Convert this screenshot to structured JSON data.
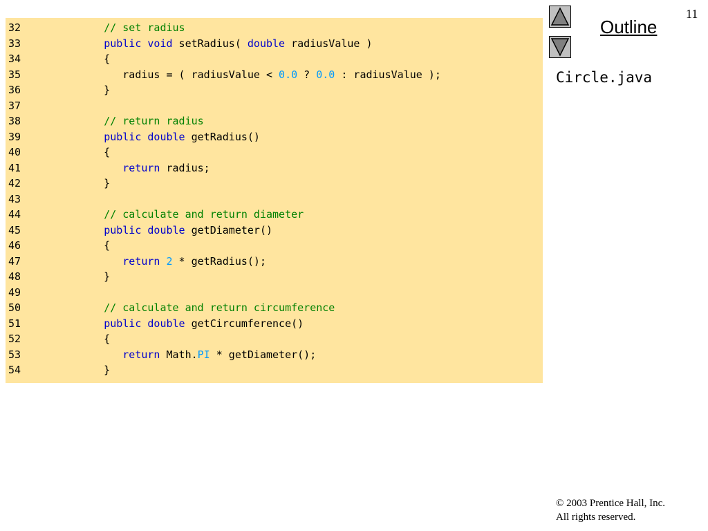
{
  "slide": {
    "page_number": "11",
    "outline_label": "Outline",
    "filename": "Circle.java",
    "copyright_line1": "© 2003 Prentice Hall, Inc.",
    "copyright_line2": "All rights reserved."
  },
  "nav": {
    "up_icon": "triangle-up-icon",
    "down_icon": "triangle-down-icon"
  },
  "colors": {
    "code_background": "#ffe59f",
    "keyword": "#0000cc",
    "comment": "#008000",
    "literal": "#0099ff"
  },
  "code": [
    {
      "ln": "32",
      "tokens": [
        {
          "t": "      "
        },
        {
          "t": "// set radius",
          "c": "cm"
        }
      ]
    },
    {
      "ln": "33",
      "tokens": [
        {
          "t": "      "
        },
        {
          "t": "public",
          "c": "kw"
        },
        {
          "t": " "
        },
        {
          "t": "void",
          "c": "kw"
        },
        {
          "t": " setRadius( "
        },
        {
          "t": "double",
          "c": "kw"
        },
        {
          "t": " radiusValue )"
        }
      ]
    },
    {
      "ln": "34",
      "tokens": [
        {
          "t": "      {"
        }
      ]
    },
    {
      "ln": "35",
      "tokens": [
        {
          "t": "         radius = ( radiusValue < "
        },
        {
          "t": "0.0",
          "c": "num"
        },
        {
          "t": " ? "
        },
        {
          "t": "0.0",
          "c": "num"
        },
        {
          "t": " : radiusValue );"
        }
      ]
    },
    {
      "ln": "36",
      "tokens": [
        {
          "t": "      }"
        }
      ]
    },
    {
      "ln": "37",
      "tokens": []
    },
    {
      "ln": "38",
      "tokens": [
        {
          "t": "      "
        },
        {
          "t": "// return radius",
          "c": "cm"
        }
      ]
    },
    {
      "ln": "39",
      "tokens": [
        {
          "t": "      "
        },
        {
          "t": "public",
          "c": "kw"
        },
        {
          "t": " "
        },
        {
          "t": "double",
          "c": "kw"
        },
        {
          "t": " getRadius()"
        }
      ]
    },
    {
      "ln": "40",
      "tokens": [
        {
          "t": "      {"
        }
      ]
    },
    {
      "ln": "41",
      "tokens": [
        {
          "t": "         "
        },
        {
          "t": "return",
          "c": "kw"
        },
        {
          "t": " radius;"
        }
      ]
    },
    {
      "ln": "42",
      "tokens": [
        {
          "t": "      }"
        }
      ]
    },
    {
      "ln": "43",
      "tokens": []
    },
    {
      "ln": "44",
      "tokens": [
        {
          "t": "      "
        },
        {
          "t": "// calculate and return diameter",
          "c": "cm"
        }
      ]
    },
    {
      "ln": "45",
      "tokens": [
        {
          "t": "      "
        },
        {
          "t": "public",
          "c": "kw"
        },
        {
          "t": " "
        },
        {
          "t": "double",
          "c": "kw"
        },
        {
          "t": " getDiameter()"
        }
      ]
    },
    {
      "ln": "46",
      "tokens": [
        {
          "t": "      {"
        }
      ]
    },
    {
      "ln": "47",
      "tokens": [
        {
          "t": "         "
        },
        {
          "t": "return",
          "c": "kw"
        },
        {
          "t": " "
        },
        {
          "t": "2",
          "c": "num"
        },
        {
          "t": " * getRadius();"
        }
      ]
    },
    {
      "ln": "48",
      "tokens": [
        {
          "t": "      }"
        }
      ]
    },
    {
      "ln": "49",
      "tokens": []
    },
    {
      "ln": "50",
      "tokens": [
        {
          "t": "      "
        },
        {
          "t": "// calculate and return circumference",
          "c": "cm"
        }
      ]
    },
    {
      "ln": "51",
      "tokens": [
        {
          "t": "      "
        },
        {
          "t": "public",
          "c": "kw"
        },
        {
          "t": " "
        },
        {
          "t": "double",
          "c": "kw"
        },
        {
          "t": " getCircumference()"
        }
      ]
    },
    {
      "ln": "52",
      "tokens": [
        {
          "t": "      {"
        }
      ]
    },
    {
      "ln": "53",
      "tokens": [
        {
          "t": "         "
        },
        {
          "t": "return",
          "c": "kw"
        },
        {
          "t": " Math."
        },
        {
          "t": "PI",
          "c": "pi"
        },
        {
          "t": " * getDiameter();"
        }
      ]
    },
    {
      "ln": "54",
      "tokens": [
        {
          "t": "      }"
        }
      ]
    }
  ]
}
